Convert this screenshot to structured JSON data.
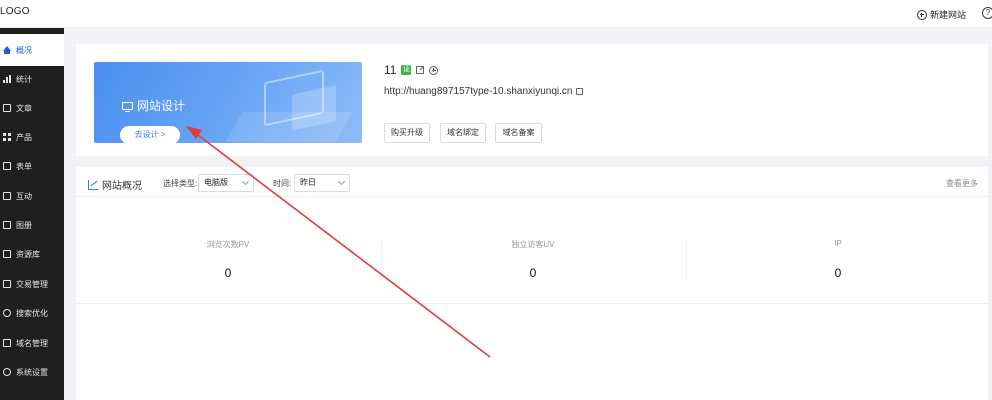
{
  "header": {
    "logo": "LOGO",
    "new_site_label": "新建网站",
    "help_glyph": "?"
  },
  "sidebar": {
    "items": [
      {
        "label": "概况",
        "icon": "home-icon",
        "active": true
      },
      {
        "label": "统计",
        "icon": "stats-icon"
      },
      {
        "label": "文章",
        "icon": "article-icon"
      },
      {
        "label": "产品",
        "icon": "product-icon"
      },
      {
        "label": "表单",
        "icon": "form-icon"
      },
      {
        "label": "互动",
        "icon": "comment-icon"
      },
      {
        "label": "图册",
        "icon": "album-icon"
      },
      {
        "label": "资源库",
        "icon": "resource-icon"
      },
      {
        "label": "交易管理",
        "icon": "trade-icon"
      },
      {
        "label": "搜索优化",
        "icon": "seo-icon"
      },
      {
        "label": "域名管理",
        "icon": "domain-icon"
      },
      {
        "label": "系统设置",
        "icon": "settings-icon"
      }
    ]
  },
  "site_card": {
    "banner_title": "网站设计",
    "design_button": "去设计 >",
    "site_name": "11",
    "cert_badge": "证",
    "site_url": "http://huang897157type-10.shanxiyunqi.cn",
    "buttons": [
      "购买升级",
      "域名绑定",
      "域名备案"
    ]
  },
  "overview": {
    "title": "网站概况",
    "type_label": "选择类型:",
    "type_value": "电脑版",
    "time_label": "时间:",
    "time_value": "昨日",
    "more_link": "查看更多",
    "stats": [
      {
        "label": "浏览次数PV",
        "value": "0"
      },
      {
        "label": "独立访客UV",
        "value": "0"
      },
      {
        "label": "IP",
        "value": "0"
      }
    ]
  },
  "colors": {
    "sidebar_bg": "#1f1f1f",
    "accent": "#3a7de8",
    "annotation_arrow": "#e23b3b",
    "cert_badge": "#43b649"
  }
}
